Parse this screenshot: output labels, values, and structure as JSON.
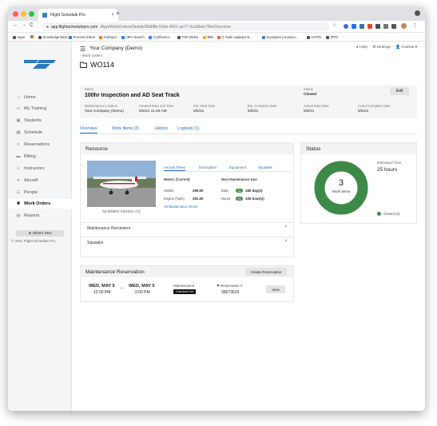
{
  "browser": {
    "tab_title": "Flight Schedule Pro",
    "tab_close": "×",
    "new_tab": "+",
    "url_host": "app.flightschedulepro.com",
    "url_path": "/App/WorkOrders/Details/80df8b-52eb-4601-ae77-9a1dbde7f9e/Overview",
    "nav_back": "←",
    "nav_forward": "→",
    "nav_reload": "C",
    "bookmarks": [
      "Apps",
      "",
      "Knowledge Base",
      "Process Street",
      "HubSpot",
      "JIRA Search",
      "Confluence",
      "FSP Slides",
      "Bills",
      "G Suite Updates B...",
      "Examples (Anonym...",
      "eCFRs",
      "IPFD"
    ],
    "star": "☆"
  },
  "header": {
    "company": "Your Company (Demo)",
    "help": "Help",
    "settings": "Settings",
    "user": "Andrew"
  },
  "breadcrumb": "‹ Work Orders",
  "page_title": "WO114",
  "sidebar": {
    "items": [
      {
        "label": "Home",
        "icon": "home-icon",
        "glyph": "⌂"
      },
      {
        "label": "My Training",
        "icon": "training-icon",
        "glyph": "▭"
      },
      {
        "label": "Students",
        "icon": "students-icon",
        "glyph": "▣"
      },
      {
        "label": "Schedule",
        "icon": "calendar-icon",
        "glyph": "▦"
      },
      {
        "label": "Reservations",
        "icon": "reservations-icon",
        "glyph": "≡"
      },
      {
        "label": "Billing",
        "icon": "billing-icon",
        "glyph": "▬"
      },
      {
        "label": "Instructors",
        "icon": "instructors-icon",
        "glyph": "☺"
      },
      {
        "label": "Aircraft",
        "icon": "aircraft-icon",
        "glyph": "✈"
      },
      {
        "label": "People",
        "icon": "people-icon",
        "glyph": "☷"
      },
      {
        "label": "Work Orders",
        "icon": "wrench-icon",
        "glyph": "✖"
      },
      {
        "label": "Reports",
        "icon": "reports-icon",
        "glyph": "▤"
      }
    ],
    "whats_new": "★ What's New",
    "copyright": "© 2021 Flight Schedule Pro"
  },
  "summary": {
    "name_label": "Name",
    "name": "100hr Inspection and AD Seat Track",
    "status_label": "Status",
    "status": "Closed",
    "edit": "Edit",
    "fields": [
      {
        "label": "Maintenance Location",
        "value": "Your Company (Demo)"
      },
      {
        "label": "Created Date and Time",
        "value": "5/5/21 11:26 AM"
      },
      {
        "label": "Est. Start Date",
        "value": "5/5/21"
      },
      {
        "label": "Est. Complete Date",
        "value": "5/6/21"
      },
      {
        "label": "Actual Start Date",
        "value": "5/5/21"
      },
      {
        "label": "Actual Complete Date",
        "value": "5/5/21"
      }
    ]
  },
  "tabs": [
    "Overview",
    "Work Items (3)",
    "History",
    "Logbook (1)"
  ],
  "resource": {
    "title": "Resource",
    "caption": "N4-0066R2 CESSNA 172",
    "subtabs": [
      "Aircraft Times",
      "Description",
      "Equipment",
      "Squawks"
    ],
    "times_header": "Meters (Current)",
    "due_header": "Next Maintenance Due",
    "rows": [
      {
        "label": "Hobbs",
        "value": "299.00",
        "due_label": "Date",
        "due_pill": "OK",
        "due_value": "180 day(s)"
      },
      {
        "label": "Engine (Tach)",
        "value": "251.00",
        "due_label": "Hours",
        "due_pill": "OK",
        "due_value": "100 hour(s)"
      }
    ],
    "link": "All Maintenance Times",
    "reminders": "Maintenance Reminders",
    "squawks": "Squawks"
  },
  "reservation": {
    "title": "Maintenance Reservation",
    "create": "Create Reservation",
    "start_date": "WED, MAY 5",
    "start_time": "12:00 PM",
    "arrow": "→",
    "end_date": "WED, MAY 5",
    "end_time": "2:00 PM",
    "type": "Maintenance",
    "badge": "Checked Out",
    "res_label": "Reservation #",
    "res_number": "35073615",
    "view": "View"
  },
  "status_card": {
    "title": "Status",
    "count": "3",
    "count_label": "Work Items",
    "estimated_label": "Estimated Time",
    "estimated_value": "25 hours",
    "legend": "Closed (3)",
    "donut_color": "#3d8a48"
  }
}
